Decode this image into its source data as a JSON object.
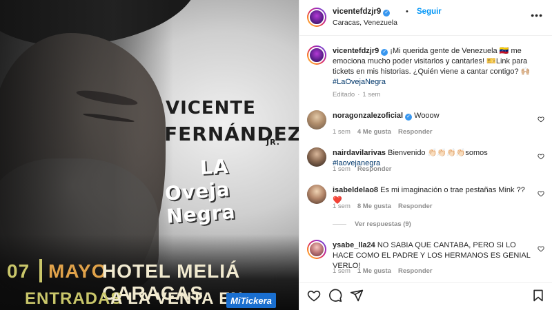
{
  "poster": {
    "name1": "VICENTE",
    "name2": "FERNÁNDEZ",
    "jr": "JR.",
    "title1": "LA",
    "title2": "Oveja Negra",
    "date": "07",
    "month": "MAYO",
    "venue": "HOTEL MELIÁ CARACAS",
    "entradas": "ENTRADAS",
    "venta": "A LA VENTA EN",
    "tickera": "MiTickera"
  },
  "header": {
    "username": "vicentefdzjr9",
    "dot": "•",
    "follow": "Seguir",
    "location": "Caracas, Venezuela",
    "more": "•••"
  },
  "caption": {
    "username": "vicentefdzjr9",
    "text": " ¡Mi querida gente de Venezuela 🇻🇪 me emociona mucho poder visitarlos y cantarles! 🎫Link para tickets en mis historias. ¿Quién viene a cantar contigo? 🙌🏼 ",
    "hashtag": "#LaOvejaNegra",
    "edited": "Editado",
    "time": "1 sem"
  },
  "comments": [
    {
      "username": "noragonzalezoficial",
      "text": " Wooow",
      "tag": "",
      "time": "1 sem",
      "likes": "4 Me gusta",
      "reply": "Responder"
    },
    {
      "username": "nairdavilarivas",
      "text": " Bienvenido 👏🏻👏🏻👏🏻👏🏻somos ",
      "tag": "#laovejanegra",
      "time": "1 sem",
      "likes": "",
      "reply": "Responder"
    },
    {
      "username": "isabeldelao8",
      "text": " Es mi imaginación o trae pestañas Mink ?? ❤️",
      "tag": "",
      "time": "1 sem",
      "likes": "8 Me gusta",
      "reply": "Responder"
    },
    {
      "username": "ysabe_lla24",
      "text": " NO SABIA QUE CANTABA, PERO SI LO HACE COMO EL PADRE Y LOS HERMANOS ES GENIAL VERLO!",
      "tag": "",
      "time": "1 sem",
      "likes": "1 Me gusta",
      "reply": "Responder"
    }
  ],
  "view_replies": "Ver respuestas (9)",
  "colors": {
    "accent": "#0095f6",
    "verified": "#3897f0",
    "muted": "#8e8e8e"
  }
}
